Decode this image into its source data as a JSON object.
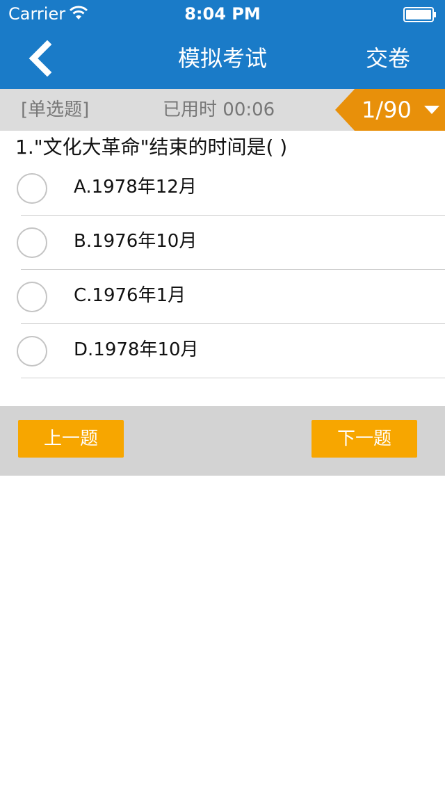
{
  "status_bar": {
    "carrier": "Carrier",
    "time": "8:04 PM"
  },
  "nav": {
    "title": "模拟考试",
    "submit_label": "交卷"
  },
  "info": {
    "question_type": "[单选题]",
    "timer_label": "已用时",
    "timer_value": "00:06",
    "progress": "1/90"
  },
  "question": {
    "text": "1.\"文化大革命\"结束的时间是( )",
    "options": [
      {
        "label": "A.1978年12月"
      },
      {
        "label": "B.1976年10月"
      },
      {
        "label": "C.1976年1月"
      },
      {
        "label": "D.1978年10月"
      }
    ]
  },
  "footer": {
    "prev_label": "上一题",
    "next_label": "下一题"
  },
  "colors": {
    "header_blue": "#1a7bc8",
    "accent_orange": "#e8900a",
    "button_orange": "#f7a600"
  },
  "icons": {
    "back": "chevron-left-icon",
    "wifi": "wifi-icon",
    "battery": "battery-icon",
    "dropdown": "caret-down-icon",
    "radio": "radio-empty-icon"
  }
}
